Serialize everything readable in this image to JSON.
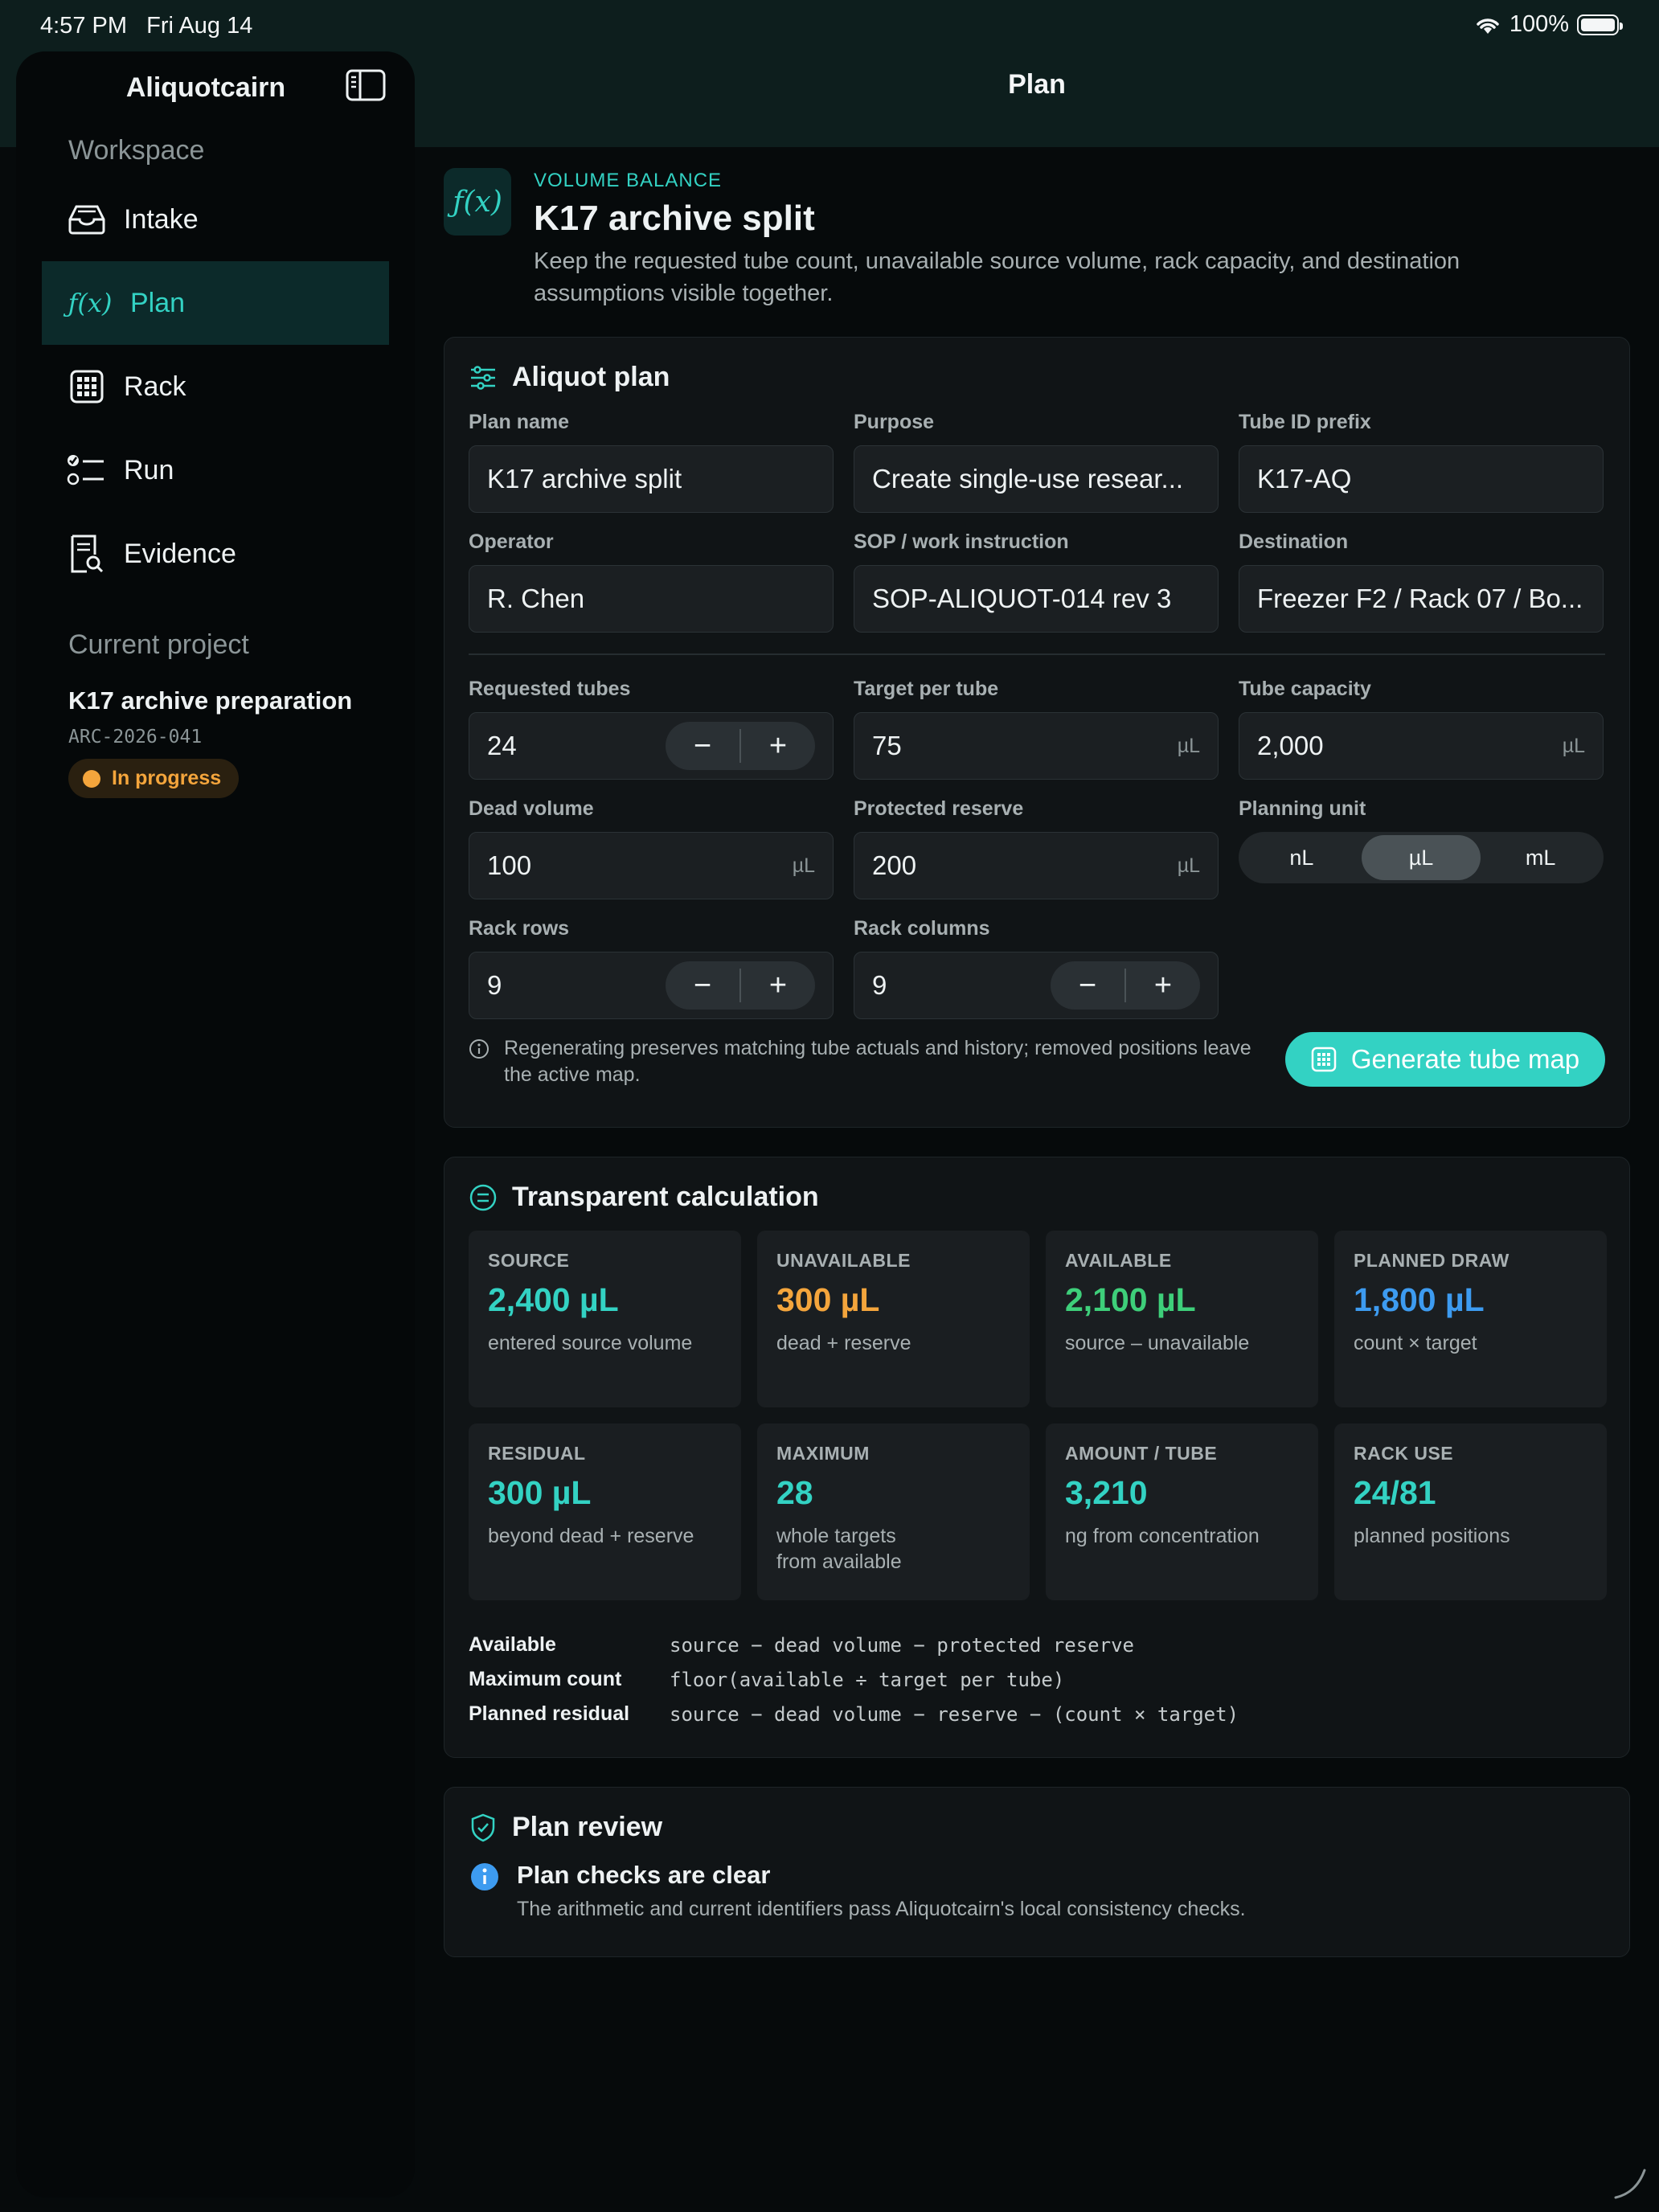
{
  "status": {
    "time": "4:57 PM",
    "date": "Fri Aug 14",
    "battery": "100%"
  },
  "sidebar": {
    "app_name": "Aliquotcairn",
    "workspace_label": "Workspace",
    "items": [
      {
        "label": "Intake",
        "icon": "tray-icon"
      },
      {
        "label": "Plan",
        "icon": "function-icon",
        "active": true
      },
      {
        "label": "Rack",
        "icon": "grid-icon"
      },
      {
        "label": "Run",
        "icon": "checklist-icon"
      },
      {
        "label": "Evidence",
        "icon": "document-search-icon"
      }
    ],
    "current_project_label": "Current project",
    "project": {
      "name": "K17 archive preparation",
      "code": "ARC-2026-041",
      "status": "In progress"
    }
  },
  "header": {
    "title": "Plan"
  },
  "hero": {
    "kicker": "VOLUME BALANCE",
    "icon_text": "ƒ(x)",
    "title": "K17 archive split",
    "description": "Keep the requested tube count, unavailable source volume, rack capacity, and destination assumptions visible together."
  },
  "aliquot_plan": {
    "title": "Aliquot plan",
    "plan_name": {
      "label": "Plan name",
      "value": "K17 archive split"
    },
    "purpose": {
      "label": "Purpose",
      "value": "Create single-use resear..."
    },
    "tube_prefix": {
      "label": "Tube ID prefix",
      "value": "K17-AQ"
    },
    "operator": {
      "label": "Operator",
      "value": "R. Chen"
    },
    "sop": {
      "label": "SOP / work instruction",
      "value": "SOP-ALIQUOT-014 rev 3"
    },
    "destination": {
      "label": "Destination",
      "value": "Freezer F2 / Rack 07 / Bo..."
    },
    "requested_tubes": {
      "label": "Requested tubes",
      "value": "24"
    },
    "target_per_tube": {
      "label": "Target per tube",
      "value": "75",
      "unit": "µL"
    },
    "tube_capacity": {
      "label": "Tube capacity",
      "value": "2,000",
      "unit": "µL"
    },
    "dead_volume": {
      "label": "Dead volume",
      "value": "100",
      "unit": "µL"
    },
    "protected_reserve": {
      "label": "Protected reserve",
      "value": "200",
      "unit": "µL"
    },
    "planning_unit": {
      "label": "Planning unit",
      "options": [
        "nL",
        "µL",
        "mL"
      ],
      "selected": "µL"
    },
    "rack_rows": {
      "label": "Rack rows",
      "value": "9"
    },
    "rack_columns": {
      "label": "Rack columns",
      "value": "9"
    },
    "note": "Regenerating preserves matching tube actuals and history; removed positions leave the active map.",
    "generate_label": "Generate tube map",
    "stepper_minus": "−",
    "stepper_plus": "+"
  },
  "calculation": {
    "title": "Transparent calculation",
    "metrics": [
      {
        "label": "SOURCE",
        "value": "2,400 µL",
        "sub": "entered source volume",
        "color": "#33d2c3"
      },
      {
        "label": "UNAVAILABLE",
        "value": "300 µL",
        "sub": "dead + reserve",
        "color": "#f4a53c"
      },
      {
        "label": "AVAILABLE",
        "value": "2,100 µL",
        "sub": "source – unavailable",
        "color": "#3ecf7a"
      },
      {
        "label": "PLANNED DRAW",
        "value": "1,800 µL",
        "sub": "count × target",
        "color": "#3d9bf0"
      },
      {
        "label": "RESIDUAL",
        "value": "300 µL",
        "sub": "beyond dead + reserve",
        "color": "#33d2c3"
      },
      {
        "label": "MAXIMUM",
        "value": "28",
        "sub": "whole targets\nfrom available",
        "color": "#33d2c3"
      },
      {
        "label": "AMOUNT / TUBE",
        "value": "3,210",
        "sub": "ng from concentration",
        "color": "#33d2c3"
      },
      {
        "label": "RACK USE",
        "value": "24/81",
        "sub": "planned positions",
        "color": "#33d2c3"
      }
    ],
    "formulas": [
      {
        "name": "Available",
        "expr": "source − dead volume − protected reserve"
      },
      {
        "name": "Maximum count",
        "expr": "floor(available ÷ target per tube)"
      },
      {
        "name": "Planned residual",
        "expr": "source − dead volume − reserve − (count × target)"
      }
    ]
  },
  "review": {
    "title": "Plan review",
    "item_title": "Plan checks are clear",
    "item_desc": "The arithmetic and current identifiers pass Aliquotcairn's local consistency checks."
  }
}
